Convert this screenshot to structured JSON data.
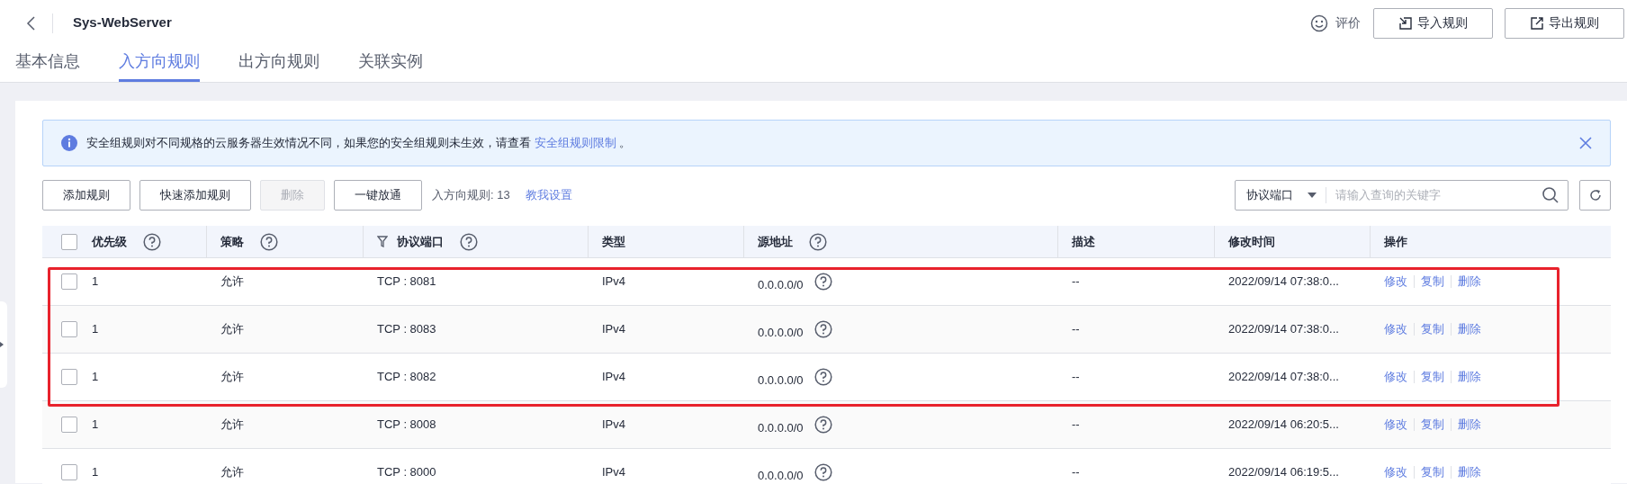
{
  "header": {
    "title": "Sys-WebServer",
    "feedback": "评价",
    "buttons": [
      {
        "label": "导入规则",
        "kind": "import"
      },
      {
        "label": "导出规则",
        "kind": "export"
      }
    ]
  },
  "tabs": [
    {
      "label": "基本信息",
      "selected": false
    },
    {
      "label": "入方向规则",
      "selected": true
    },
    {
      "label": "出方向规则",
      "selected": false
    },
    {
      "label": "关联实例",
      "selected": false
    }
  ],
  "alert": {
    "text": "安全组规则对不同规格的云服务器生效情况不同，如果您的安全组规则未生效，请查看",
    "link": "安全组规则限制",
    "tail": "。"
  },
  "toolbar": {
    "buttons": [
      {
        "label": "添加规则",
        "disabled": false
      },
      {
        "label": "快速添加规则",
        "disabled": false
      },
      {
        "label": "删除",
        "disabled": true
      },
      {
        "label": "一键放通",
        "disabled": false
      }
    ],
    "count": "入方向规则: 13",
    "help_link": "教我设置",
    "search": {
      "filter": "协议端口",
      "placeholder": "请输入查询的关键字"
    }
  },
  "table": {
    "all_checked": false,
    "columns": [
      {
        "label": "优先级",
        "help": true,
        "filter": false
      },
      {
        "label": "策略",
        "help": true,
        "filter": false
      },
      {
        "label": "协议端口",
        "help": true,
        "filter": true
      },
      {
        "label": "类型",
        "help": false,
        "filter": false
      },
      {
        "label": "源地址",
        "help": true,
        "filter": false
      },
      {
        "label": "描述",
        "help": false,
        "filter": false
      },
      {
        "label": "修改时间",
        "help": false,
        "filter": false
      },
      {
        "label": "操作",
        "help": false,
        "filter": false
      }
    ],
    "rows": [
      {
        "checked": false,
        "priority": "1",
        "action": "允许",
        "port": "TCP : 8081",
        "type": "IPv4",
        "source": "0.0.0.0/0",
        "description": "--",
        "modified": "2022/09/14 07:38:0...",
        "ops": [
          "修改",
          "复制",
          "删除"
        ]
      },
      {
        "checked": false,
        "priority": "1",
        "action": "允许",
        "port": "TCP : 8083",
        "type": "IPv4",
        "source": "0.0.0.0/0",
        "description": "--",
        "modified": "2022/09/14 07:38:0...",
        "ops": [
          "修改",
          "复制",
          "删除"
        ]
      },
      {
        "checked": false,
        "priority": "1",
        "action": "允许",
        "port": "TCP : 8082",
        "type": "IPv4",
        "source": "0.0.0.0/0",
        "description": "--",
        "modified": "2022/09/14 07:38:0...",
        "ops": [
          "修改",
          "复制",
          "删除"
        ]
      },
      {
        "checked": false,
        "priority": "1",
        "action": "允许",
        "port": "TCP : 8008",
        "type": "IPv4",
        "source": "0.0.0.0/0",
        "description": "--",
        "modified": "2022/09/14 06:20:5...",
        "ops": [
          "修改",
          "复制",
          "删除"
        ]
      },
      {
        "checked": false,
        "priority": "1",
        "action": "允许",
        "port": "TCP : 8000",
        "type": "IPv4",
        "source": "0.0.0.0/0",
        "description": "--",
        "modified": "2022/09/14 06:19:5...",
        "ops": [
          "修改",
          "复制",
          "删除"
        ]
      }
    ]
  }
}
